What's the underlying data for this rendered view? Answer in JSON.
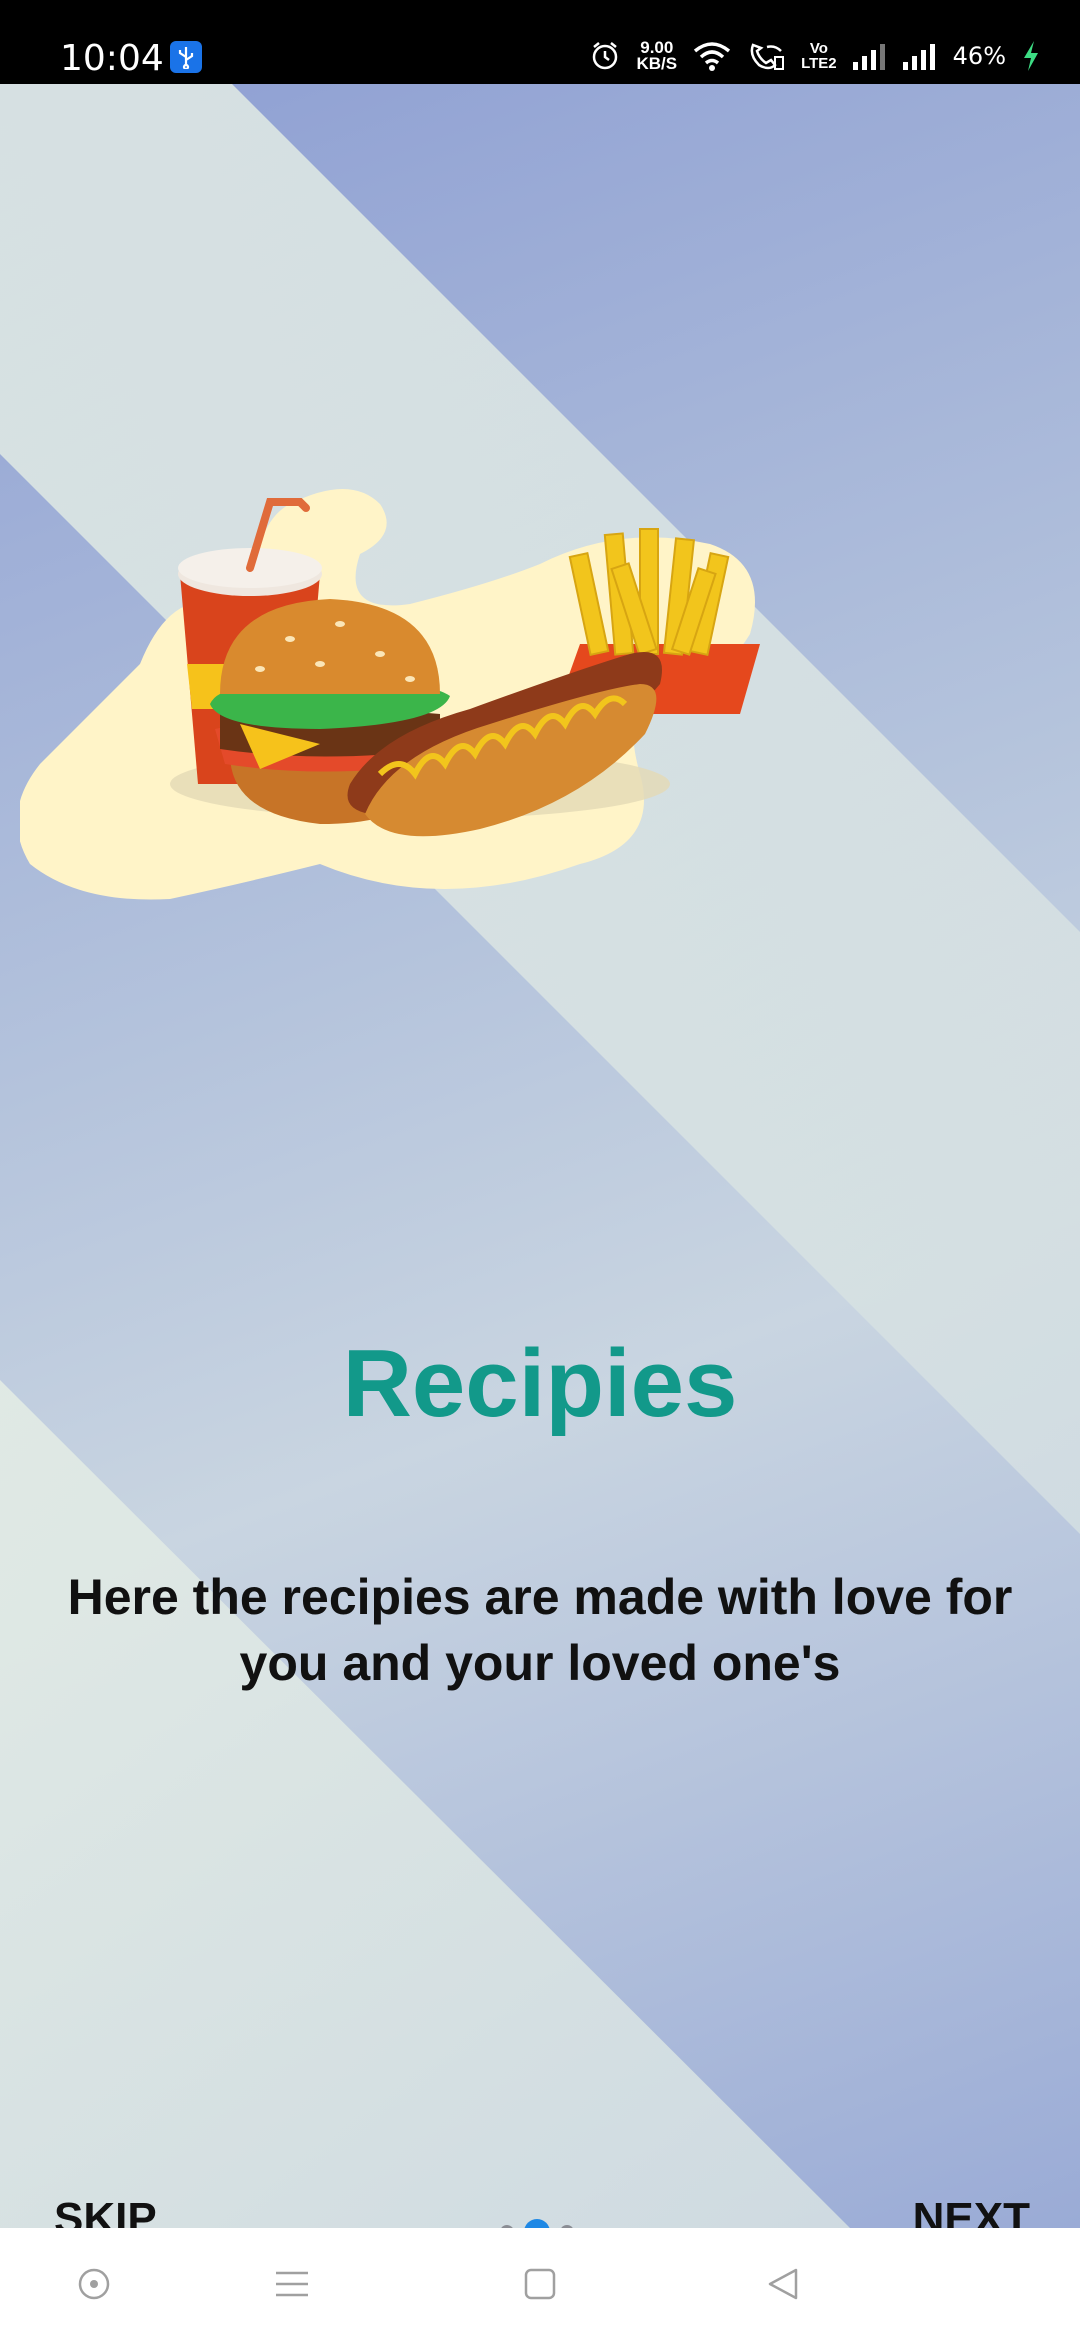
{
  "status_bar": {
    "time": "10:04",
    "net_speed_value": "9.00",
    "net_speed_unit": "KB/S",
    "volte_label_top": "Vo",
    "volte_label_bottom": "LTE2",
    "battery": "46%",
    "icons": [
      "usb-debug-icon",
      "alarm-icon",
      "wifi-icon",
      "wifi-calling-icon",
      "volte-icon",
      "signal-sim2-icon",
      "signal-sim1-icon",
      "charging-bolt-icon"
    ]
  },
  "onboarding": {
    "title": "Recipies",
    "description": "Here the recipies are made with love for you and your loved one's",
    "illustration": "fast-food-illustration",
    "skip_label": "SKIP",
    "next_label": "NEXT",
    "page_indicator": {
      "count": 3,
      "active_index": 1
    }
  },
  "nav_bar": {
    "buttons": [
      "assistant-circle-icon",
      "menu-icon",
      "home-square-icon",
      "back-triangle-icon"
    ]
  },
  "colors": {
    "title": "#12998a",
    "active_dot": "#1e88e5",
    "inactive_dot": "#8a8d94",
    "background_light": "#e2ece6",
    "background_blue": "#8e9fd3",
    "blob": "#fff4c8"
  }
}
